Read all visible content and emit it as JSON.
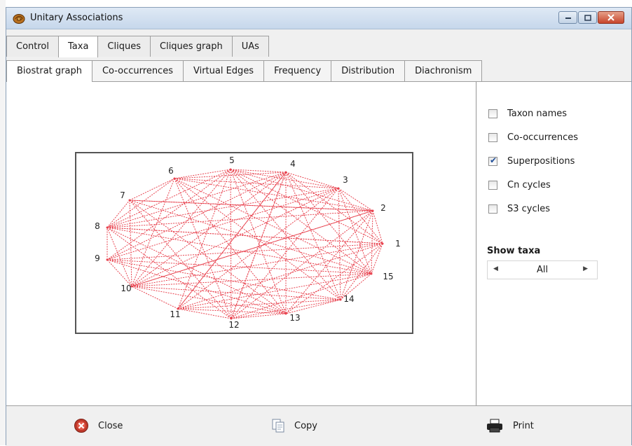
{
  "window": {
    "title": "Unitary Associations"
  },
  "tabs_main": [
    {
      "label": "Control",
      "active": false
    },
    {
      "label": "Taxa",
      "active": true
    },
    {
      "label": "Cliques",
      "active": false
    },
    {
      "label": "Cliques graph",
      "active": false
    },
    {
      "label": "UAs",
      "active": false
    }
  ],
  "tabs_sub": [
    {
      "label": "Biostrat graph",
      "active": true
    },
    {
      "label": "Co-occurrences",
      "active": false
    },
    {
      "label": "Virtual Edges",
      "active": false
    },
    {
      "label": "Frequency",
      "active": false
    },
    {
      "label": "Distribution",
      "active": false
    },
    {
      "label": "Diachronism",
      "active": false
    }
  ],
  "options": {
    "checkboxes": [
      {
        "label": "Taxon names",
        "checked": false
      },
      {
        "label": "Co-occurrences",
        "checked": false
      },
      {
        "label": "Superpositions",
        "checked": true
      },
      {
        "label": "Cn cycles",
        "checked": false
      },
      {
        "label": "S3 cycles",
        "checked": false
      }
    ],
    "show_taxa_label": "Show taxa",
    "show_taxa_value": "All"
  },
  "graph": {
    "nodes": [
      "1",
      "2",
      "3",
      "4",
      "5",
      "6",
      "7",
      "8",
      "9",
      "10",
      "11",
      "12",
      "13",
      "14",
      "15"
    ],
    "edge_color": "#e8434f"
  },
  "bottom_buttons": {
    "close": "Close",
    "copy": "Copy",
    "print": "Print"
  }
}
